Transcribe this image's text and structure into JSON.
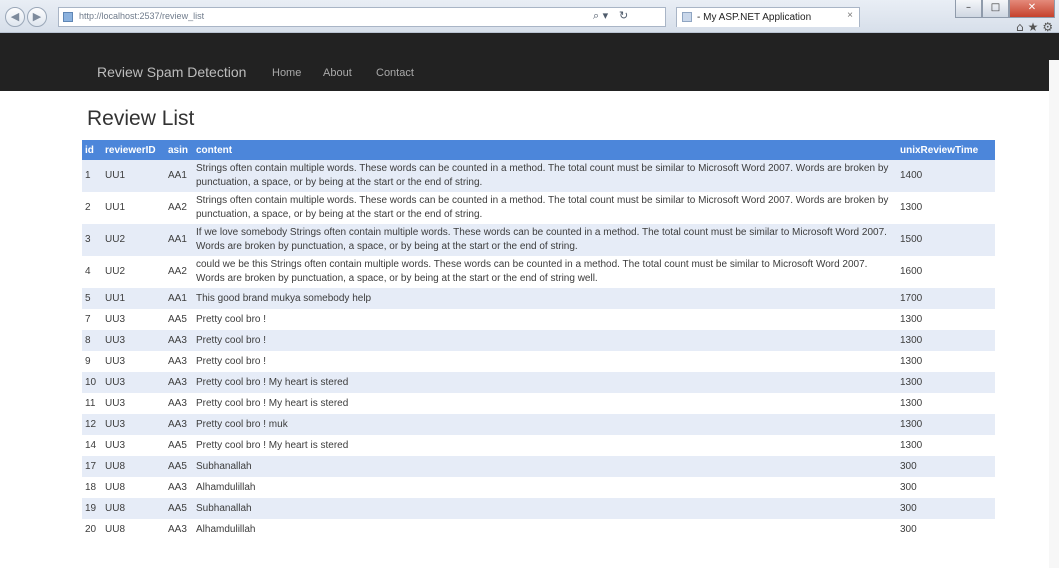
{
  "browser": {
    "url": "http://localhost:2537/review_list",
    "tab_title": "- My ASP.NET Application",
    "tab_close": "×",
    "back": "◀",
    "forward": "▶",
    "search_glyph": "⌕ ▾",
    "refresh_glyph": "↻",
    "min": "–",
    "max": "□",
    "close": "✕",
    "toolbar_icons": "⌂★⚙"
  },
  "navbar": {
    "brand": "Review Spam Detection",
    "links": [
      "Home",
      "About",
      "Contact"
    ]
  },
  "page": {
    "title": "Review List"
  },
  "table": {
    "columns": [
      "id",
      "reviewerID",
      "asin",
      "content",
      "unixReviewTime"
    ],
    "rows": [
      {
        "id": "1",
        "reviewerID": "UU1",
        "asin": "AA1",
        "content": "Strings often contain multiple words. These words can be counted in a method. The total count must be similar to Microsoft Word 2007. Words are broken by punctuation, a space, or by being at the start or the end of string.",
        "unixReviewTime": "1400"
      },
      {
        "id": "2",
        "reviewerID": "UU1",
        "asin": "AA2",
        "content": "Strings often contain multiple words. These words can be counted in a method. The total count must be similar to Microsoft Word 2007. Words are broken by punctuation, a space, or by being at the start or the end of string.",
        "unixReviewTime": "1300"
      },
      {
        "id": "3",
        "reviewerID": "UU2",
        "asin": "AA1",
        "content": "If we love somebody Strings often contain multiple words. These words can be counted in a method. The total count must be similar to Microsoft Word 2007. Words are broken by punctuation, a space, or by being at the start or the end of string.",
        "unixReviewTime": "1500"
      },
      {
        "id": "4",
        "reviewerID": "UU2",
        "asin": "AA2",
        "content": "could we be this Strings often contain multiple words. These words can be counted in a method. The total count must be similar to Microsoft Word 2007. Words are broken by punctuation, a space, or by being at the start or the end of string well.",
        "unixReviewTime": "1600"
      },
      {
        "id": "5",
        "reviewerID": "UU1",
        "asin": "AA1",
        "content": "This good brand mukya somebody help",
        "unixReviewTime": "1700"
      },
      {
        "id": "7",
        "reviewerID": "UU3",
        "asin": "AA5",
        "content": "Pretty cool bro !",
        "unixReviewTime": "1300"
      },
      {
        "id": "8",
        "reviewerID": "UU3",
        "asin": "AA3",
        "content": "Pretty cool bro !",
        "unixReviewTime": "1300"
      },
      {
        "id": "9",
        "reviewerID": "UU3",
        "asin": "AA3",
        "content": "Pretty cool bro !",
        "unixReviewTime": "1300"
      },
      {
        "id": "10",
        "reviewerID": "UU3",
        "asin": "AA3",
        "content": "Pretty cool bro ! My heart is stered",
        "unixReviewTime": "1300"
      },
      {
        "id": "11",
        "reviewerID": "UU3",
        "asin": "AA3",
        "content": "Pretty cool bro ! My heart is stered",
        "unixReviewTime": "1300"
      },
      {
        "id": "12",
        "reviewerID": "UU3",
        "asin": "AA3",
        "content": "Pretty cool bro ! muk",
        "unixReviewTime": "1300"
      },
      {
        "id": "14",
        "reviewerID": "UU3",
        "asin": "AA5",
        "content": "Pretty cool bro ! My heart is stered",
        "unixReviewTime": "1300"
      },
      {
        "id": "17",
        "reviewerID": "UU8",
        "asin": "AA5",
        "content": "Subhanallah",
        "unixReviewTime": "300"
      },
      {
        "id": "18",
        "reviewerID": "UU8",
        "asin": "AA3",
        "content": "Alhamdulillah",
        "unixReviewTime": "300"
      },
      {
        "id": "19",
        "reviewerID": "UU8",
        "asin": "AA5",
        "content": "Subhanallah",
        "unixReviewTime": "300"
      },
      {
        "id": "20",
        "reviewerID": "UU8",
        "asin": "AA3",
        "content": "Alhamdulillah",
        "unixReviewTime": "300"
      }
    ]
  },
  "colors": {
    "navbar_bg": "#222222",
    "table_header_bg": "#4c86da",
    "row_stripe": "#e6ecf7"
  }
}
